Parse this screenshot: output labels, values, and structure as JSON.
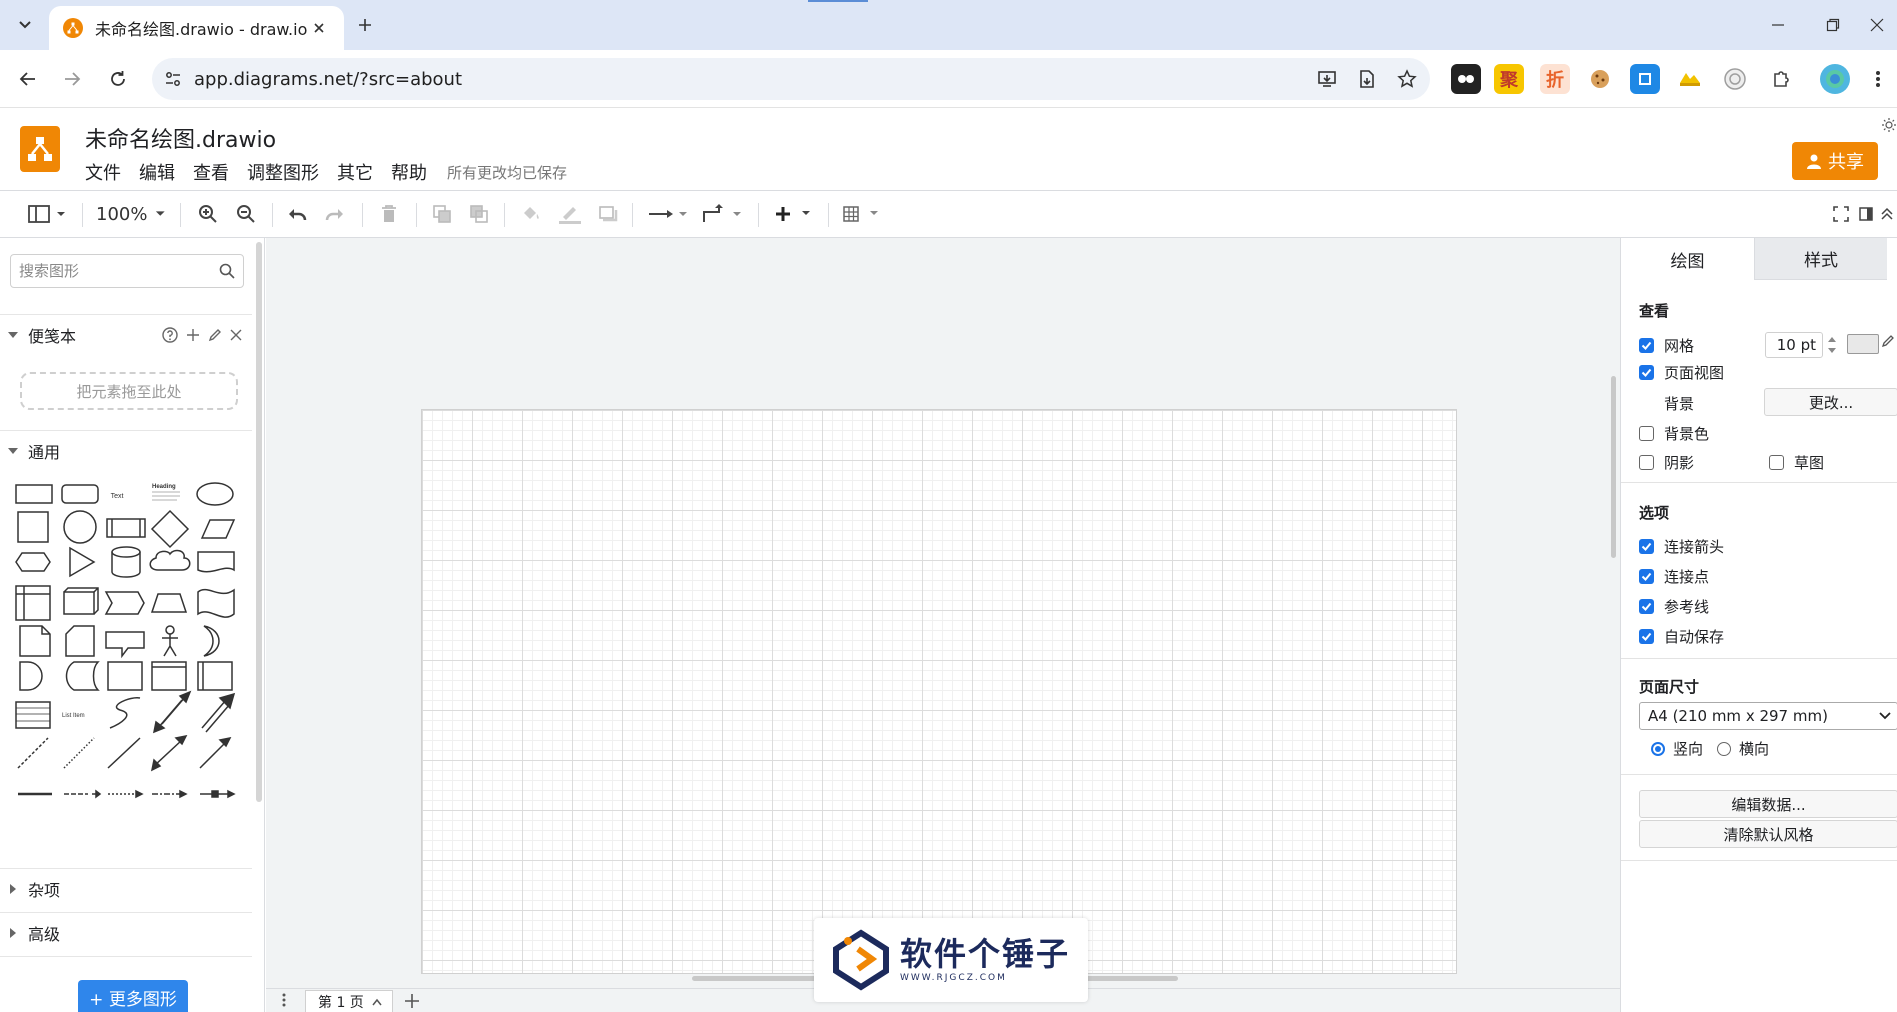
{
  "browser": {
    "tab_title": "未命名绘图.drawio - draw.io",
    "url": "app.diagrams.net/?src=about",
    "extensions": [
      {
        "name": "tampermonkey-icon",
        "label": "",
        "color": "#222222"
      },
      {
        "name": "ju-extension-icon",
        "label": "聚",
        "color": "#c0392b"
      },
      {
        "name": "zhe-extension-icon",
        "label": "折",
        "color": "#e8632b"
      },
      {
        "name": "cookie-icon",
        "label": "",
        "color": "#d9a05b"
      },
      {
        "name": "blue-extension-icon",
        "label": "",
        "color": "#1e88e5"
      },
      {
        "name": "yellow-extension-icon",
        "label": "",
        "color": "#f2c200"
      },
      {
        "name": "circle-extension-icon",
        "label": "",
        "color": "#9e9e9e"
      },
      {
        "name": "puzzle-icon",
        "label": "",
        "color": "#444444"
      }
    ]
  },
  "app": {
    "title": "未命名绘图.drawio",
    "menus": [
      "文件",
      "编辑",
      "查看",
      "调整图形",
      "其它",
      "帮助"
    ],
    "save_status": "所有更改均已保存",
    "share_label": "共享",
    "brand_color": "#f08705"
  },
  "toolbar": {
    "zoom": "100%"
  },
  "sidebar": {
    "search_placeholder": "搜索图形",
    "scratchpad_label": "便笺本",
    "dropzone_text": "把元素拖至此处",
    "general_label": "通用",
    "misc_label": "杂项",
    "advanced_label": "高级",
    "more_shapes_label": "+ 更多图形",
    "shape_text_label": "Text",
    "shape_heading_label": "Heading",
    "shape_list_label": "List Item"
  },
  "pages": {
    "current": "第 1 页"
  },
  "watermark": {
    "text": "软件个锤子",
    "sub": "WWW.RJGCZ.COM"
  },
  "format_panel": {
    "tabs": [
      "绘图",
      "样式"
    ],
    "view": {
      "title": "查看",
      "grid_label": "网格",
      "grid_checked": true,
      "grid_size": "10 pt",
      "page_view_label": "页面视图",
      "page_view_checked": true,
      "background_label": "背景",
      "change_label": "更改...",
      "bg_color_label": "背景色",
      "bg_color_checked": false,
      "shadow_label": "阴影",
      "shadow_checked": false,
      "sketch_label": "草图",
      "sketch_checked": false
    },
    "options": {
      "title": "选项",
      "items": [
        {
          "label": "连接箭头",
          "checked": true
        },
        {
          "label": "连接点",
          "checked": true
        },
        {
          "label": "参考线",
          "checked": true
        },
        {
          "label": "自动保存",
          "checked": true
        }
      ]
    },
    "page_size": {
      "title": "页面尺寸",
      "selected": "A4 (210 mm x 297 mm)",
      "portrait_label": "竖向",
      "landscape_label": "横向",
      "orientation": "portrait"
    },
    "edit_data_label": "编辑数据...",
    "clear_style_label": "清除默认风格"
  }
}
